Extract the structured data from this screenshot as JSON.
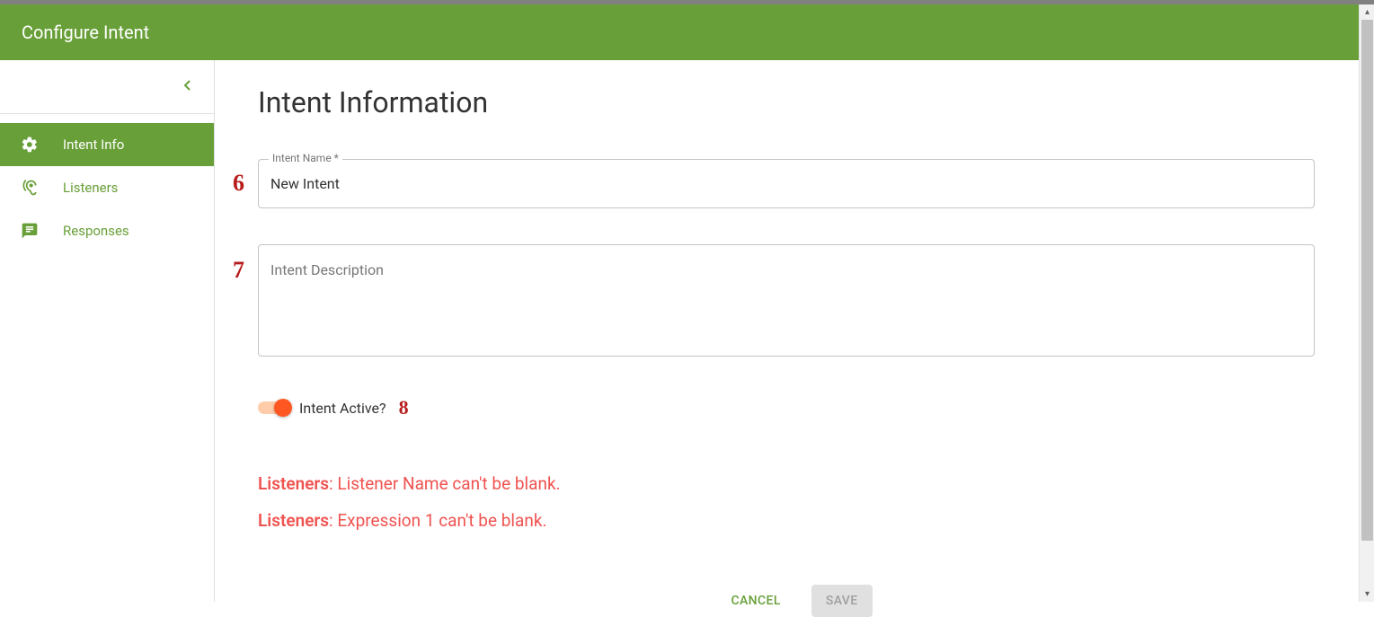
{
  "header": {
    "title": "Configure Intent"
  },
  "sidebar": {
    "items": [
      {
        "label": "Intent Info",
        "active": true
      },
      {
        "label": "Listeners",
        "active": false
      },
      {
        "label": "Responses",
        "active": false
      }
    ]
  },
  "main": {
    "title": "Intent Information",
    "intent_name_label": "Intent Name *",
    "intent_name_value": "New Intent",
    "intent_desc_placeholder": "Intent Description",
    "toggle_label": "Intent Active?",
    "toggle_on": true,
    "annotations": {
      "name": "6",
      "desc": "7",
      "toggle": "8"
    }
  },
  "errors": [
    {
      "prefix": "Listeners",
      "message": ": Listener Name can't be blank."
    },
    {
      "prefix": "Listeners",
      "message": ": Expression 1 can't be blank."
    }
  ],
  "actions": {
    "cancel": "CANCEL",
    "save": "SAVE"
  },
  "colors": {
    "primary": "#689f38",
    "accent": "#ff5722",
    "error": "#ef5350",
    "annotation": "#b71c1c"
  }
}
